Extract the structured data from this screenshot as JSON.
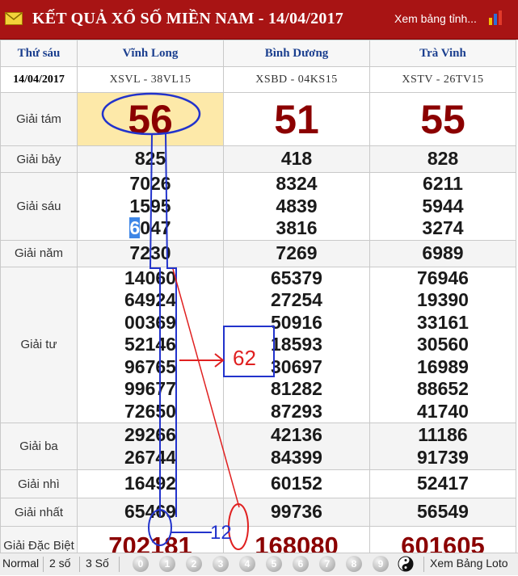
{
  "header": {
    "title": "KẾT QUẢ XỔ SỐ MIỀN NAM - 14/04/2017",
    "link": "Xem bảng tỉnh...",
    "icon_mail": "envelope-icon",
    "icon_chart": "bar-chart-icon"
  },
  "table": {
    "day": "Thứ sáu",
    "date": "14/04/2017",
    "provinces": [
      {
        "name": "Vĩnh Long",
        "code": "XSVL - 38VL15"
      },
      {
        "name": "Bình Dương",
        "code": "XSBD - 04KS15"
      },
      {
        "name": "Trà Vinh",
        "code": "XSTV - 26TV15"
      }
    ],
    "prize_labels": [
      "Giải tám",
      "Giải bảy",
      "Giải sáu",
      "Giải năm",
      "Giải tư",
      "Giải ba",
      "Giải nhì",
      "Giải nhất",
      "Giải Đặc Biệt"
    ],
    "g8": [
      "56",
      "51",
      "55"
    ],
    "g7": [
      "825",
      "418",
      "828"
    ],
    "g6": [
      [
        "7026",
        "1595",
        "6047"
      ],
      [
        "8324",
        "4839",
        "3816"
      ],
      [
        "6211",
        "5944",
        "3274"
      ]
    ],
    "g5": [
      "7230",
      "7269",
      "6989"
    ],
    "g4": [
      [
        "14060",
        "64924",
        "00369",
        "52146",
        "96765",
        "99677",
        "72650"
      ],
      [
        "65379",
        "27254",
        "50916",
        "18593",
        "30697",
        "81282",
        "87293"
      ],
      [
        "76946",
        "19390",
        "33161",
        "30560",
        "16989",
        "88652",
        "41740"
      ]
    ],
    "g3": [
      [
        "29266",
        "26744"
      ],
      [
        "42136",
        "84399"
      ],
      [
        "11186",
        "91739"
      ]
    ],
    "g2": [
      "16492",
      "60152",
      "52417"
    ],
    "g1": [
      "65469",
      "99736",
      "56549"
    ],
    "db": [
      "702181",
      "168080",
      "601605"
    ]
  },
  "annotations": {
    "handwritten_box": "62",
    "handwritten_bottom": "12"
  },
  "footer": {
    "normal": "Normal",
    "two": "2 số",
    "three": "3 Số",
    "digits": [
      "0",
      "1",
      "2",
      "3",
      "4",
      "5",
      "6",
      "7",
      "8",
      "9"
    ],
    "loto": "Xem Bảng Loto",
    "icon_yinyang": "yin-yang-icon"
  },
  "colors": {
    "header": "#a81414",
    "prize_red": "#8b0000",
    "highlight": "#fde9a9",
    "annotation_blue": "#2233cc",
    "annotation_red": "#e02020"
  }
}
